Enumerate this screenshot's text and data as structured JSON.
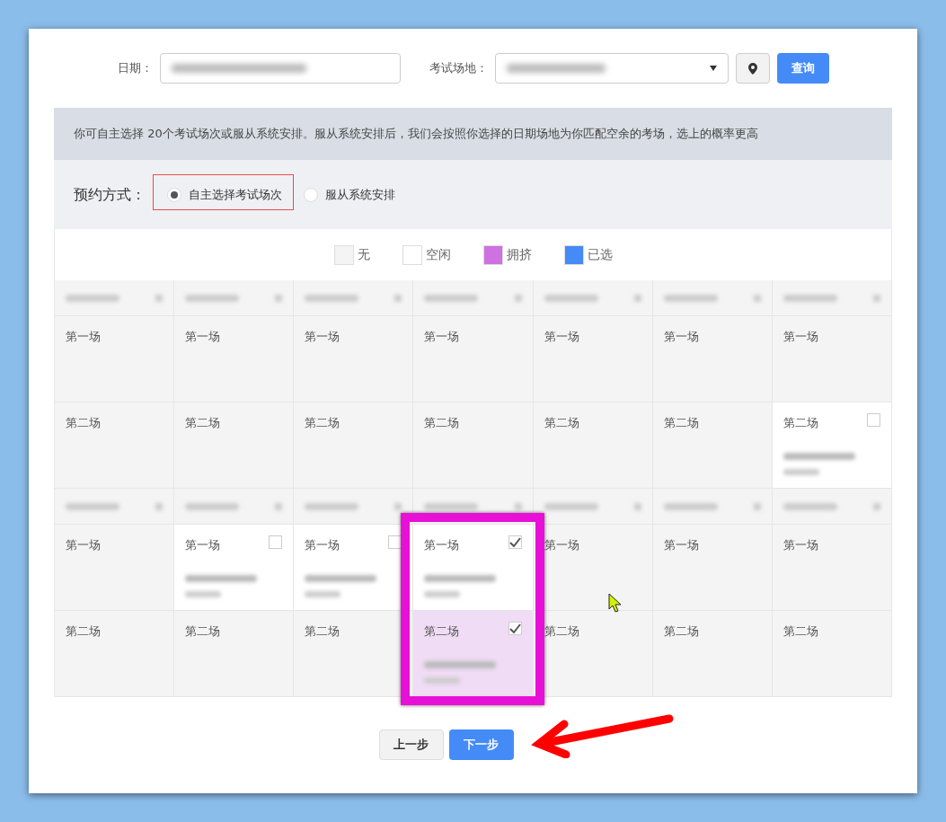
{
  "filters": {
    "date_label": "日期：",
    "venue_label": "考试场地：",
    "search_button": "查询"
  },
  "notice": "你可自主选择 20个考试场次或服从系统安排。服从系统安排后，我们会按照你选择的日期场地为你匹配空余的考场，选上的概率更高",
  "booking": {
    "label": "预约方式：",
    "options": [
      {
        "label": "自主选择考试场次",
        "selected": true
      },
      {
        "label": "服从系统安排",
        "selected": false
      }
    ]
  },
  "legend": [
    {
      "label": "无",
      "color": "#f4f4f4"
    },
    {
      "label": "空闲",
      "color": "#ffffff"
    },
    {
      "label": "拥挤",
      "color": "#cd72e0"
    },
    {
      "label": "已选",
      "color": "#448bf7"
    }
  ],
  "weeks": [
    {
      "rows": [
        {
          "cells": [
            {
              "label": "第一场",
              "kind": "none"
            },
            {
              "label": "第一场",
              "kind": "none"
            },
            {
              "label": "第一场",
              "kind": "none"
            },
            {
              "label": "第一场",
              "kind": "none"
            },
            {
              "label": "第一场",
              "kind": "none"
            },
            {
              "label": "第一场",
              "kind": "none"
            },
            {
              "label": "第一场",
              "kind": "none"
            }
          ]
        },
        {
          "cells": [
            {
              "label": "第二场",
              "kind": "none"
            },
            {
              "label": "第二场",
              "kind": "none"
            },
            {
              "label": "第二场",
              "kind": "none"
            },
            {
              "label": "第二场",
              "kind": "none"
            },
            {
              "label": "第二场",
              "kind": "none"
            },
            {
              "label": "第二场",
              "kind": "none"
            },
            {
              "label": "第二场",
              "kind": "free",
              "checked": false
            }
          ]
        }
      ]
    },
    {
      "rows": [
        {
          "cells": [
            {
              "label": "第一场",
              "kind": "none"
            },
            {
              "label": "第一场",
              "kind": "free",
              "checked": false
            },
            {
              "label": "第一场",
              "kind": "free",
              "checked": false
            },
            {
              "label": "第一场",
              "kind": "free",
              "checked": true
            },
            {
              "label": "第一场",
              "kind": "none"
            },
            {
              "label": "第一场",
              "kind": "none"
            },
            {
              "label": "第一场",
              "kind": "none"
            }
          ]
        },
        {
          "cells": [
            {
              "label": "第二场",
              "kind": "none"
            },
            {
              "label": "第二场",
              "kind": "none"
            },
            {
              "label": "第二场",
              "kind": "none"
            },
            {
              "label": "第二场",
              "kind": "crowded",
              "checked": true
            },
            {
              "label": "第二场",
              "kind": "none"
            },
            {
              "label": "第二场",
              "kind": "none"
            },
            {
              "label": "第二场",
              "kind": "none"
            }
          ]
        }
      ]
    }
  ],
  "buttons": {
    "prev": "上一步",
    "next": "下一步"
  }
}
